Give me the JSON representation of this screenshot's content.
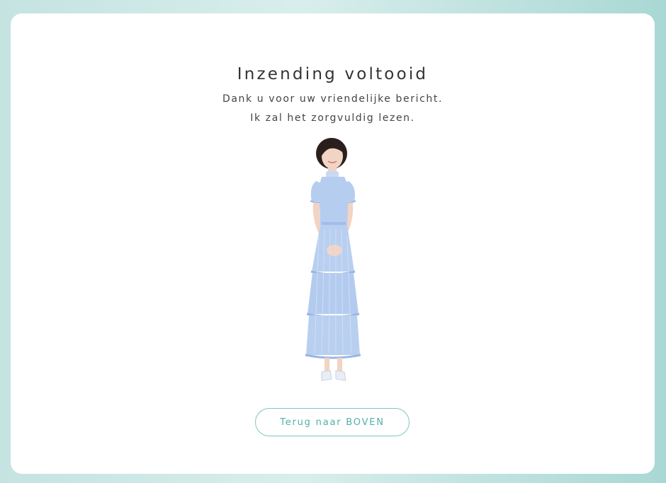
{
  "page": {
    "title": "Inzending voltooid",
    "message_lines": [
      "Dank u voor uw vriendelijke bericht.",
      "Ik zal het zorgvuldig lezen."
    ],
    "button_label": "Terug naar BOVEN"
  },
  "colors": {
    "background_left": "#c4e3e1",
    "background_right": "#a9d8d4",
    "card": "#ffffff",
    "accent": "#4fb0a9",
    "accent_border": "#7cc6c0",
    "text": "#333333",
    "dress": "#b5cdef"
  }
}
